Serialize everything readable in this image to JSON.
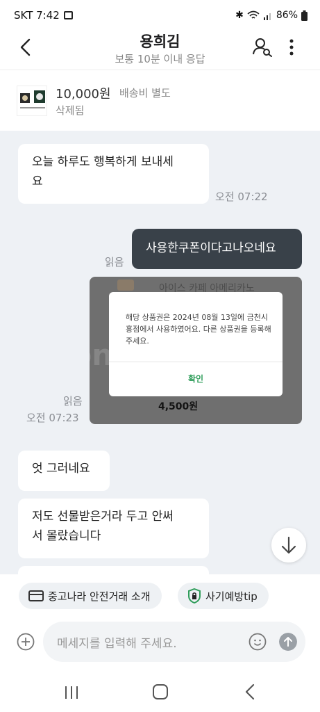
{
  "status_bar": {
    "carrier_time": "SKT 7:42",
    "battery": "86%"
  },
  "header": {
    "title": "용희김",
    "subtitle": "보통 10분 이내 응답"
  },
  "product": {
    "price": "10,000원",
    "shipping": "배송비 별도",
    "status": "삭제됨"
  },
  "messages": [
    {
      "text_line1": "오늘 하루도 행복하게 보내세",
      "text_line2": "요",
      "time": "오전 07:22"
    },
    {
      "text": "사용한쿠폰이다고나오네요",
      "read": "읽음"
    },
    {
      "read": "읽음",
      "time": "오전 07:23"
    },
    {
      "text": "엇 그러네요"
    },
    {
      "text_line1": "저도 선물받은거라 두고 안써",
      "text_line2": "서 몰랐습니다"
    }
  ],
  "coupon_image": {
    "product_name": "아이스 카페 아메리카노",
    "price": "4,500원",
    "dialog_message": "해당 상품권은 2024년 08월 13일에 금천시흥점에서 사용하였어요. 다른 상품권을 등록해 주세요.",
    "dialog_button": "확인"
  },
  "chips": {
    "safe_trade": "중고나라 안전거래 소개",
    "fraud_tip": "사기예방tip"
  },
  "composer": {
    "placeholder": "메세지를 입력해 주세요."
  },
  "colors": {
    "my_bubble": "#394149",
    "accent_green": "#2f9d5a",
    "chat_bg": "#eef1f5"
  }
}
